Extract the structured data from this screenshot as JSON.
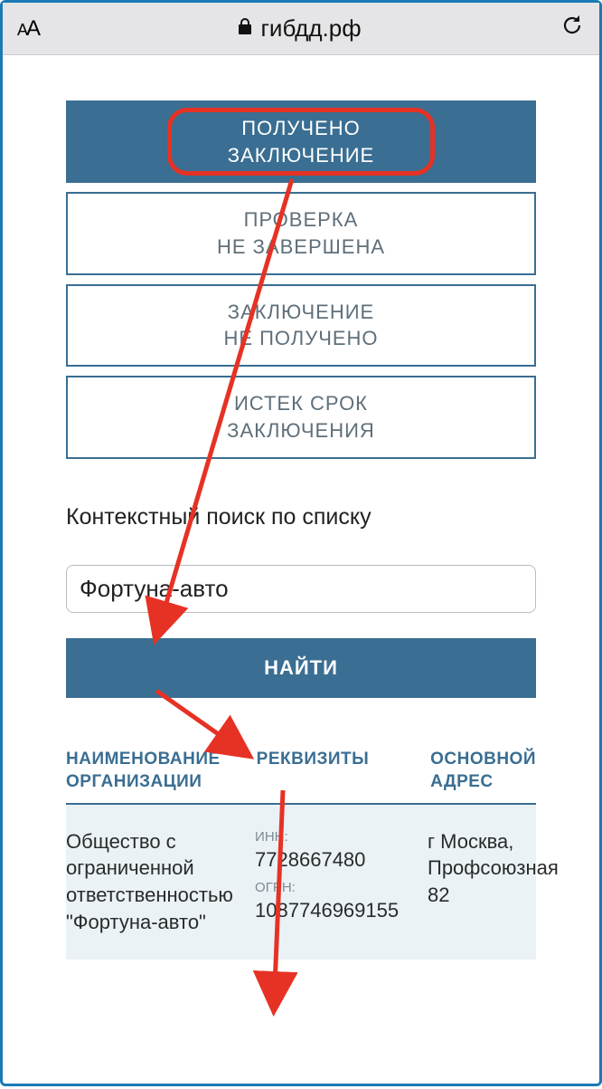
{
  "browser": {
    "url": "гибдд.рф"
  },
  "filters": {
    "active": {
      "line1": "ПОЛУЧЕНО",
      "line2": "ЗАКЛЮЧЕНИЕ"
    },
    "f2": {
      "line1": "ПРОВЕРКА",
      "line2": "НЕ ЗАВЕРШЕНА"
    },
    "f3": {
      "line1": "ЗАКЛЮЧЕНИЕ",
      "line2": "НЕ ПОЛУЧЕНО"
    },
    "f4": {
      "line1": "ИСТЕК СРОК",
      "line2": "ЗАКЛЮЧЕНИЯ"
    }
  },
  "search": {
    "label": "Контекстный поиск по списку",
    "value": "Фортуна-авто",
    "button": "НАЙТИ"
  },
  "table": {
    "headers": {
      "name": "НАИМЕНОВАНИЕ ОРГАНИЗАЦИИ",
      "requisites": "РЕКВИЗИТЫ",
      "address": "ОСНОВНОЙ АДРЕС"
    },
    "row": {
      "name": "Общество с ограниченной ответственностью \"Фортуна-авто\"",
      "inn_label": "ИНН:",
      "inn": "7728667480",
      "ogrn_label": "ОГРН:",
      "ogrn": "1087746969155",
      "address": "г Москва, Профсоюзная 82"
    }
  }
}
